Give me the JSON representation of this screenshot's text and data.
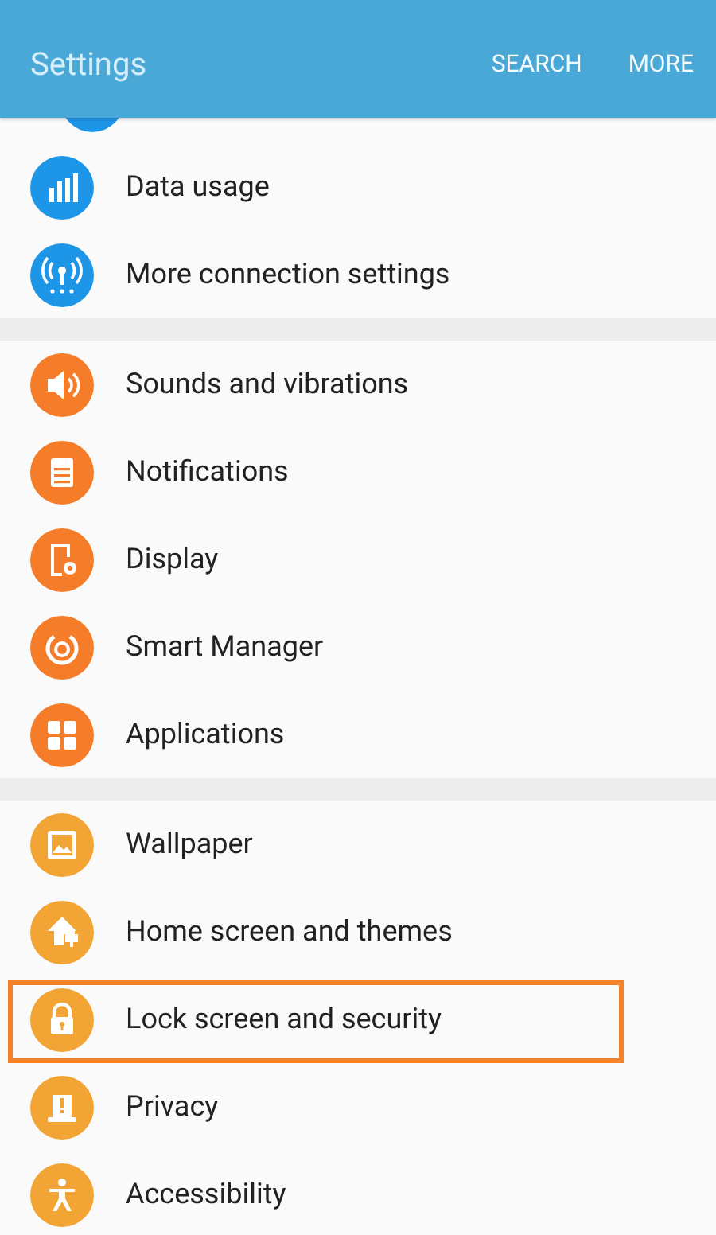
{
  "header": {
    "title": "Settings",
    "actions": [
      "SEARCH",
      "MORE"
    ]
  },
  "groups": [
    {
      "color": "#1e96e8",
      "items": [
        {
          "label": "Data usage",
          "kind": "bars",
          "highlighted": false
        },
        {
          "label": "More connection settings",
          "kind": "antenna",
          "highlighted": false
        }
      ]
    },
    {
      "color": "#f57c28",
      "items": [
        {
          "label": "Sounds and vibrations",
          "kind": "speaker",
          "highlighted": false
        },
        {
          "label": "Notifications",
          "kind": "notes",
          "highlighted": false
        },
        {
          "label": "Display",
          "kind": "display",
          "highlighted": false
        },
        {
          "label": "Smart Manager",
          "kind": "power",
          "highlighted": false
        },
        {
          "label": "Applications",
          "kind": "grid",
          "highlighted": false
        }
      ]
    },
    {
      "color": "#f2a535",
      "items": [
        {
          "label": "Wallpaper",
          "kind": "image",
          "highlighted": false
        },
        {
          "label": "Home screen and themes",
          "kind": "home",
          "highlighted": false
        },
        {
          "label": "Lock screen and security",
          "kind": "lock",
          "highlighted": true
        },
        {
          "label": "Privacy",
          "kind": "alert",
          "highlighted": false
        },
        {
          "label": "Accessibility",
          "kind": "person",
          "highlighted": false
        }
      ]
    }
  ]
}
